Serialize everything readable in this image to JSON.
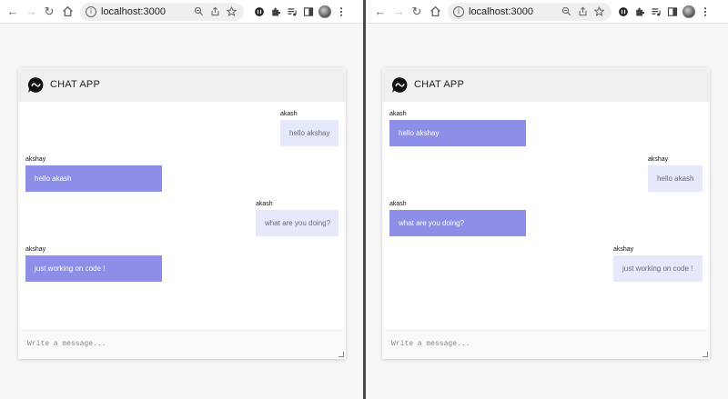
{
  "browser": {
    "url": "localhost:3000"
  },
  "left": {
    "title": "CHAT APP",
    "placeholder": "Write a message...",
    "messages": [
      {
        "sender": "akash",
        "text": "hello akshay",
        "side": "mine"
      },
      {
        "sender": "akshay",
        "text": "hello akash",
        "side": "theirs"
      },
      {
        "sender": "akash",
        "text": "what are you doing?",
        "side": "mine"
      },
      {
        "sender": "akshay",
        "text": "just working on code !",
        "side": "theirs"
      }
    ]
  },
  "right": {
    "title": "CHAT APP",
    "placeholder": "Write a message...",
    "messages": [
      {
        "sender": "akash",
        "text": "hello akshay",
        "side": "theirs"
      },
      {
        "sender": "akshay",
        "text": "hello akash",
        "side": "mine"
      },
      {
        "sender": "akash",
        "text": "what are you doing?",
        "side": "theirs"
      },
      {
        "sender": "akshay",
        "text": "just working on code !",
        "side": "mine"
      }
    ]
  },
  "colors": {
    "own_bubble": "#e6e8fb",
    "other_bubble": "#8c8ee8",
    "header_bg": "#f0f0f0"
  }
}
